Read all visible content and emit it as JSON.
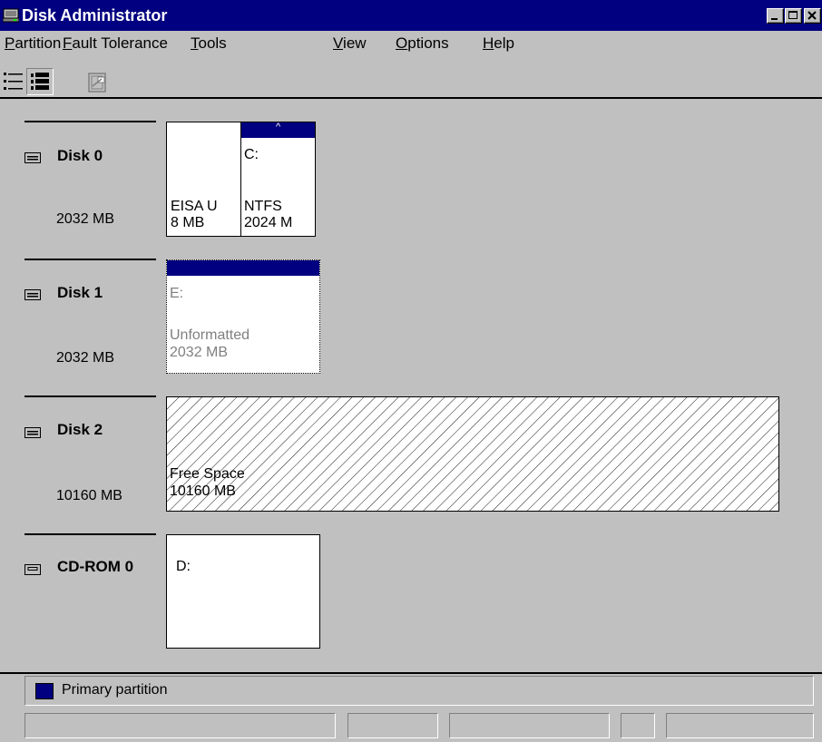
{
  "window": {
    "title": "Disk Administrator"
  },
  "menu": {
    "items": [
      {
        "accel": "P",
        "rest": "artition"
      },
      {
        "accel": "F",
        "rest": "ault Tolerance"
      },
      {
        "accel": "T",
        "rest": "ools"
      },
      {
        "accel": "V",
        "rest": "iew"
      },
      {
        "accel": "O",
        "rest": "ptions"
      },
      {
        "accel": "H",
        "rest": "elp"
      }
    ]
  },
  "toolbar": {
    "buttons": [
      "list-view-icon",
      "detail-view-icon",
      "properties-icon"
    ]
  },
  "disks": [
    {
      "label": "Disk 0",
      "size": "2032 MB",
      "icon": "hard-disk-icon",
      "partitions": [
        {
          "drive": "",
          "fs": "EISA U",
          "size": "8 MB"
        },
        {
          "drive": "C:",
          "fs": "NTFS",
          "size": "2024 M",
          "arrow": "^"
        }
      ]
    },
    {
      "label": "Disk 1",
      "size": "2032 MB",
      "icon": "hard-disk-icon",
      "partitions": [
        {
          "drive": "E:",
          "fs": "Unformatted",
          "size": "2032 MB"
        }
      ]
    },
    {
      "label": "Disk 2",
      "size": "10160 MB",
      "icon": "hard-disk-icon",
      "partitions": [
        {
          "drive": "",
          "fs": "Free Space",
          "size": "10160 MB"
        }
      ]
    },
    {
      "label": "CD-ROM 0",
      "size": "",
      "icon": "cdrom-icon",
      "partitions": [
        {
          "drive": "D:",
          "fs": "",
          "size": ""
        }
      ]
    }
  ],
  "legend": {
    "label": "Primary partition",
    "color": "#000080"
  }
}
